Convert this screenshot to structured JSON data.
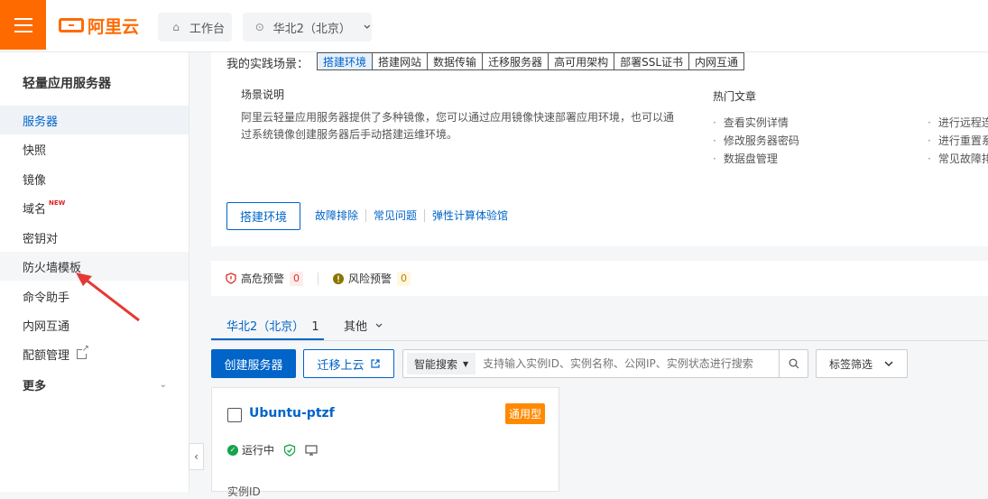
{
  "header": {
    "logo_text": "阿里云",
    "workbench_label": "工作台",
    "region_label": "华北2（北京）"
  },
  "sidebar": {
    "title": "轻量应用服务器",
    "items": [
      {
        "label": "服务器",
        "state": "active"
      },
      {
        "label": "快照"
      },
      {
        "label": "镜像"
      },
      {
        "label": "域名",
        "badge": "NEW"
      },
      {
        "label": "密钥对"
      },
      {
        "label": "防火墙模板",
        "state": "hover"
      },
      {
        "label": "命令助手"
      },
      {
        "label": "内网互通"
      },
      {
        "label": "配额管理",
        "icon": "external-link-icon"
      },
      {
        "label": "更多",
        "icon": "chevron-down-icon"
      }
    ]
  },
  "scenario": {
    "label": "我的实践场景：",
    "tabs": [
      "搭建环境",
      "搭建网站",
      "数据传输",
      "迁移服务器",
      "高可用架构",
      "部署SSL证书",
      "内网互通"
    ],
    "active_tab": 0,
    "desc_title": "场景说明",
    "desc_text": "阿里云轻量应用服务器提供了多种镜像，您可以通过应用镜像快速部署应用环境，也可以通过系统镜像创建服务器后手动搭建运维环境。",
    "hot_title": "热门文章",
    "hot_col1": [
      "查看实例详情",
      "修改服务器密码",
      "数据盘管理"
    ],
    "hot_col2": [
      "进行远程连",
      "进行重置系",
      "常见故障排"
    ],
    "action_button": "搭建环境",
    "links": [
      "故障排除",
      "常见问题",
      "弹性计算体验馆"
    ]
  },
  "alerts": {
    "high_label": "高危预警",
    "high_count": "0",
    "risk_label": "风险预警",
    "risk_count": "0"
  },
  "region_tabs": {
    "current": "华北2（北京）",
    "current_count": "1",
    "other": "其他"
  },
  "toolbar": {
    "create_label": "创建服务器",
    "migrate_label": "迁移上云",
    "search_mode": "智能搜索",
    "search_placeholder": "支持输入实例ID、实例名称、公网IP、实例状态进行搜索",
    "tag_filter": "标签筛选"
  },
  "instance": {
    "name": "Ubuntu-ptzf",
    "type": "通用型",
    "status": "运行中",
    "id_label": "实例ID"
  },
  "colors": {
    "brand": "#ff6a00",
    "primary": "#0064c8",
    "annotation_arrow": "#e53935"
  }
}
